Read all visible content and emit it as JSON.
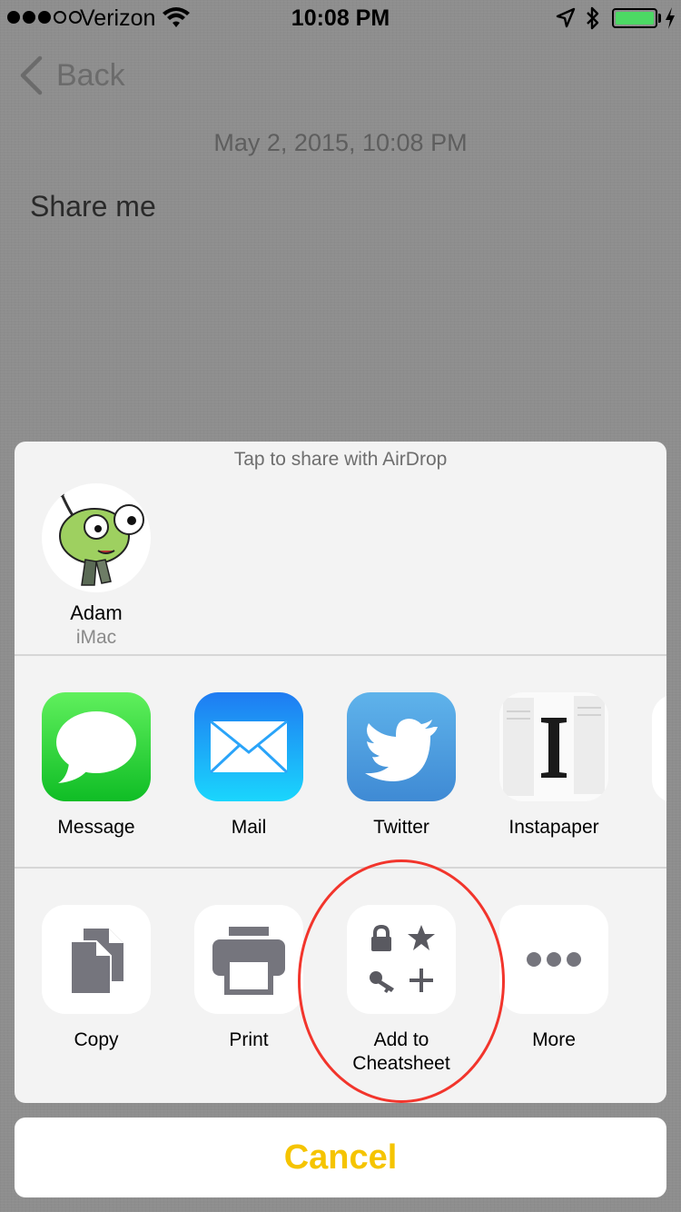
{
  "status_bar": {
    "carrier": "Verizon",
    "time": "10:08 PM",
    "signal_bars_filled": 3,
    "signal_bars_total": 5,
    "battery_color": "#4cd964",
    "icons": [
      "wifi-icon",
      "location-icon",
      "bluetooth-icon",
      "battery-icon",
      "charging-icon"
    ]
  },
  "nav": {
    "back_label": "Back"
  },
  "note": {
    "date": "May 2, 2015, 10:08 PM",
    "text": "Share me"
  },
  "share_sheet": {
    "airdrop_title": "Tap to share with AirDrop",
    "airdrop_device": {
      "name": "Adam",
      "type": "iMac"
    },
    "share_apps": [
      {
        "label": "Message",
        "icon": "message-icon"
      },
      {
        "label": "Mail",
        "icon": "mail-icon"
      },
      {
        "label": "Twitter",
        "icon": "twitter-icon"
      },
      {
        "label": "Instapaper",
        "icon": "instapaper-icon"
      }
    ],
    "actions": [
      {
        "label": "Copy",
        "icon": "copy-icon"
      },
      {
        "label": "Print",
        "icon": "print-icon"
      },
      {
        "label": "Add to Cheatsheet",
        "icon": "cheatsheet-icon"
      },
      {
        "label": "More",
        "icon": "more-icon"
      }
    ],
    "cancel_label": "Cancel",
    "cancel_color": "#f5c400",
    "highlight_color": "#f2352c"
  }
}
